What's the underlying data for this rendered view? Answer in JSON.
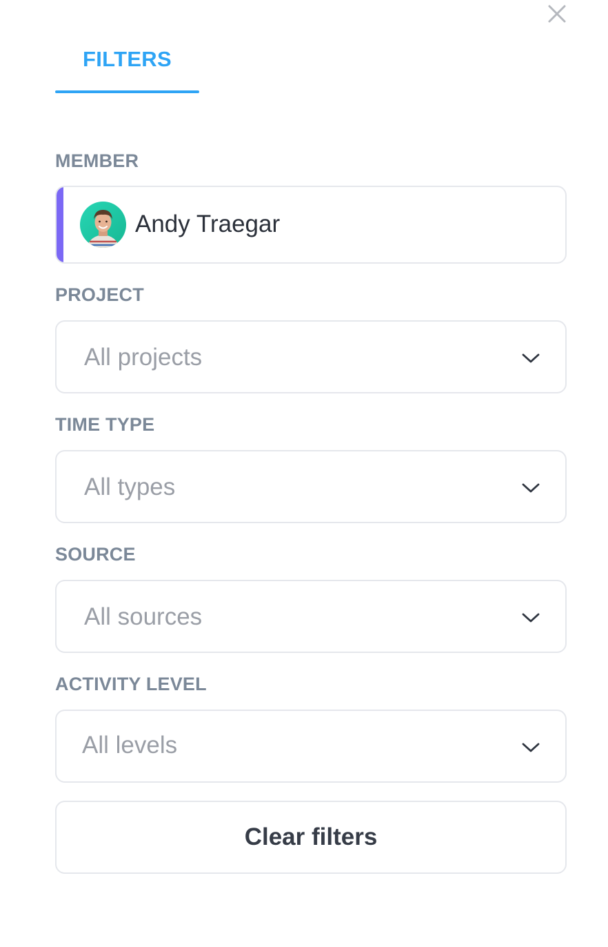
{
  "header": {
    "close_icon": "close-icon",
    "tab_label": "FILTERS",
    "accent_color": "#2ea4f5"
  },
  "member": {
    "label": "MEMBER",
    "name": "Andy Traegar",
    "accent_color": "#7b68f5"
  },
  "project": {
    "label": "PROJECT",
    "value": "All projects"
  },
  "time_type": {
    "label": "TIME TYPE",
    "value": "All types"
  },
  "source": {
    "label": "SOURCE",
    "value": "All sources"
  },
  "activity_level": {
    "label": "ACTIVITY LEVEL",
    "value": "All levels"
  },
  "actions": {
    "clear_label": "Clear filters"
  }
}
